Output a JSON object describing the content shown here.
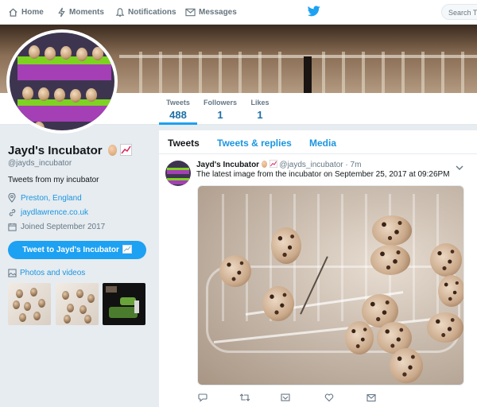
{
  "nav": {
    "home": "Home",
    "moments": "Moments",
    "notifications": "Notifications",
    "messages": "Messages",
    "search_placeholder": "Search Twitter"
  },
  "profile": {
    "name": "Jayd's Incubator",
    "handle": "@jayds_incubator",
    "bio": "Tweets from my incubator",
    "location": "Preston, England",
    "website": "jaydlawrence.co.uk",
    "joined": "Joined September 2017",
    "tweet_to_button": "Tweet to Jayd's Incubator",
    "photos_videos_link": "Photos and videos"
  },
  "stats": [
    {
      "label": "Tweets",
      "value": "488"
    },
    {
      "label": "Followers",
      "value": "1"
    },
    {
      "label": "Likes",
      "value": "1"
    }
  ],
  "tabs": [
    "Tweets",
    "Tweets & replies",
    "Media"
  ],
  "tweet": {
    "author": "Jayd's Incubator",
    "handle": "@jayds_incubator",
    "time": "· 7m",
    "text": "The latest image from the incubator on September 25, 2017 at 09:26PM"
  },
  "colors": {
    "accent": "#1da1f2",
    "link": "#1b95e0"
  }
}
